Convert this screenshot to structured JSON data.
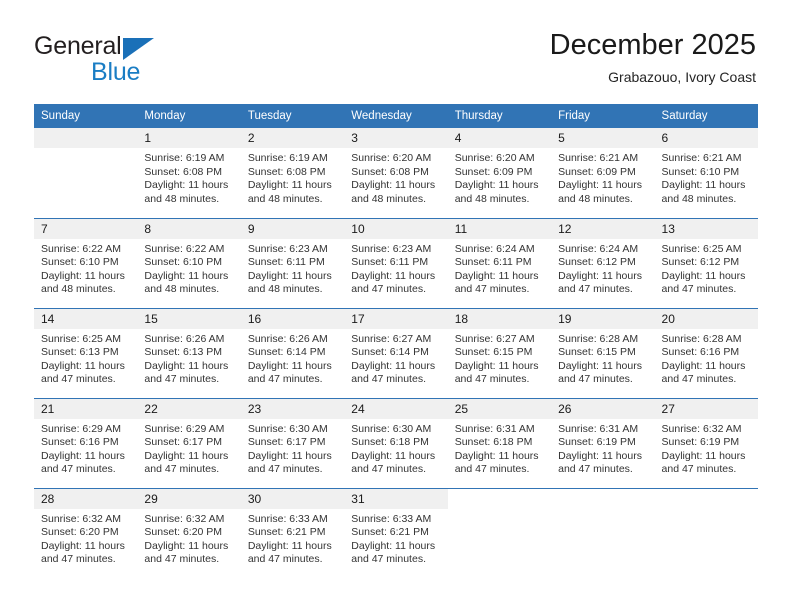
{
  "brand": {
    "name_dark": "General",
    "name_blue": "Blue",
    "triangle_icon": "triangle-icon",
    "accent_color": "#1a70b8"
  },
  "header": {
    "title": "December 2025",
    "subtitle": "Grabazouo, Ivory Coast"
  },
  "colors": {
    "header_blue": "#3174b5",
    "daynum_band": "#f0f0f0",
    "text": "#333333"
  },
  "calendar": {
    "weekday_headers": [
      "Sunday",
      "Monday",
      "Tuesday",
      "Wednesday",
      "Thursday",
      "Friday",
      "Saturday"
    ],
    "weeks": [
      [
        {
          "day": "",
          "sunrise": "",
          "sunset": "",
          "daylight": "",
          "state": "empty"
        },
        {
          "day": "1",
          "sunrise": "Sunrise: 6:19 AM",
          "sunset": "Sunset: 6:08 PM",
          "daylight": "Daylight: 11 hours and 48 minutes.",
          "state": "filled"
        },
        {
          "day": "2",
          "sunrise": "Sunrise: 6:19 AM",
          "sunset": "Sunset: 6:08 PM",
          "daylight": "Daylight: 11 hours and 48 minutes.",
          "state": "filled"
        },
        {
          "day": "3",
          "sunrise": "Sunrise: 6:20 AM",
          "sunset": "Sunset: 6:08 PM",
          "daylight": "Daylight: 11 hours and 48 minutes.",
          "state": "filled"
        },
        {
          "day": "4",
          "sunrise": "Sunrise: 6:20 AM",
          "sunset": "Sunset: 6:09 PM",
          "daylight": "Daylight: 11 hours and 48 minutes.",
          "state": "filled"
        },
        {
          "day": "5",
          "sunrise": "Sunrise: 6:21 AM",
          "sunset": "Sunset: 6:09 PM",
          "daylight": "Daylight: 11 hours and 48 minutes.",
          "state": "filled"
        },
        {
          "day": "6",
          "sunrise": "Sunrise: 6:21 AM",
          "sunset": "Sunset: 6:10 PM",
          "daylight": "Daylight: 11 hours and 48 minutes.",
          "state": "filled"
        }
      ],
      [
        {
          "day": "7",
          "sunrise": "Sunrise: 6:22 AM",
          "sunset": "Sunset: 6:10 PM",
          "daylight": "Daylight: 11 hours and 48 minutes.",
          "state": "filled"
        },
        {
          "day": "8",
          "sunrise": "Sunrise: 6:22 AM",
          "sunset": "Sunset: 6:10 PM",
          "daylight": "Daylight: 11 hours and 48 minutes.",
          "state": "filled"
        },
        {
          "day": "9",
          "sunrise": "Sunrise: 6:23 AM",
          "sunset": "Sunset: 6:11 PM",
          "daylight": "Daylight: 11 hours and 48 minutes.",
          "state": "filled"
        },
        {
          "day": "10",
          "sunrise": "Sunrise: 6:23 AM",
          "sunset": "Sunset: 6:11 PM",
          "daylight": "Daylight: 11 hours and 47 minutes.",
          "state": "filled"
        },
        {
          "day": "11",
          "sunrise": "Sunrise: 6:24 AM",
          "sunset": "Sunset: 6:11 PM",
          "daylight": "Daylight: 11 hours and 47 minutes.",
          "state": "filled"
        },
        {
          "day": "12",
          "sunrise": "Sunrise: 6:24 AM",
          "sunset": "Sunset: 6:12 PM",
          "daylight": "Daylight: 11 hours and 47 minutes.",
          "state": "filled"
        },
        {
          "day": "13",
          "sunrise": "Sunrise: 6:25 AM",
          "sunset": "Sunset: 6:12 PM",
          "daylight": "Daylight: 11 hours and 47 minutes.",
          "state": "filled"
        }
      ],
      [
        {
          "day": "14",
          "sunrise": "Sunrise: 6:25 AM",
          "sunset": "Sunset: 6:13 PM",
          "daylight": "Daylight: 11 hours and 47 minutes.",
          "state": "filled"
        },
        {
          "day": "15",
          "sunrise": "Sunrise: 6:26 AM",
          "sunset": "Sunset: 6:13 PM",
          "daylight": "Daylight: 11 hours and 47 minutes.",
          "state": "filled"
        },
        {
          "day": "16",
          "sunrise": "Sunrise: 6:26 AM",
          "sunset": "Sunset: 6:14 PM",
          "daylight": "Daylight: 11 hours and 47 minutes.",
          "state": "filled"
        },
        {
          "day": "17",
          "sunrise": "Sunrise: 6:27 AM",
          "sunset": "Sunset: 6:14 PM",
          "daylight": "Daylight: 11 hours and 47 minutes.",
          "state": "filled"
        },
        {
          "day": "18",
          "sunrise": "Sunrise: 6:27 AM",
          "sunset": "Sunset: 6:15 PM",
          "daylight": "Daylight: 11 hours and 47 minutes.",
          "state": "filled"
        },
        {
          "day": "19",
          "sunrise": "Sunrise: 6:28 AM",
          "sunset": "Sunset: 6:15 PM",
          "daylight": "Daylight: 11 hours and 47 minutes.",
          "state": "filled"
        },
        {
          "day": "20",
          "sunrise": "Sunrise: 6:28 AM",
          "sunset": "Sunset: 6:16 PM",
          "daylight": "Daylight: 11 hours and 47 minutes.",
          "state": "filled"
        }
      ],
      [
        {
          "day": "21",
          "sunrise": "Sunrise: 6:29 AM",
          "sunset": "Sunset: 6:16 PM",
          "daylight": "Daylight: 11 hours and 47 minutes.",
          "state": "filled"
        },
        {
          "day": "22",
          "sunrise": "Sunrise: 6:29 AM",
          "sunset": "Sunset: 6:17 PM",
          "daylight": "Daylight: 11 hours and 47 minutes.",
          "state": "filled"
        },
        {
          "day": "23",
          "sunrise": "Sunrise: 6:30 AM",
          "sunset": "Sunset: 6:17 PM",
          "daylight": "Daylight: 11 hours and 47 minutes.",
          "state": "filled"
        },
        {
          "day": "24",
          "sunrise": "Sunrise: 6:30 AM",
          "sunset": "Sunset: 6:18 PM",
          "daylight": "Daylight: 11 hours and 47 minutes.",
          "state": "filled"
        },
        {
          "day": "25",
          "sunrise": "Sunrise: 6:31 AM",
          "sunset": "Sunset: 6:18 PM",
          "daylight": "Daylight: 11 hours and 47 minutes.",
          "state": "filled"
        },
        {
          "day": "26",
          "sunrise": "Sunrise: 6:31 AM",
          "sunset": "Sunset: 6:19 PM",
          "daylight": "Daylight: 11 hours and 47 minutes.",
          "state": "filled"
        },
        {
          "day": "27",
          "sunrise": "Sunrise: 6:32 AM",
          "sunset": "Sunset: 6:19 PM",
          "daylight": "Daylight: 11 hours and 47 minutes.",
          "state": "filled"
        }
      ],
      [
        {
          "day": "28",
          "sunrise": "Sunrise: 6:32 AM",
          "sunset": "Sunset: 6:20 PM",
          "daylight": "Daylight: 11 hours and 47 minutes.",
          "state": "filled"
        },
        {
          "day": "29",
          "sunrise": "Sunrise: 6:32 AM",
          "sunset": "Sunset: 6:20 PM",
          "daylight": "Daylight: 11 hours and 47 minutes.",
          "state": "filled"
        },
        {
          "day": "30",
          "sunrise": "Sunrise: 6:33 AM",
          "sunset": "Sunset: 6:21 PM",
          "daylight": "Daylight: 11 hours and 47 minutes.",
          "state": "filled"
        },
        {
          "day": "31",
          "sunrise": "Sunrise: 6:33 AM",
          "sunset": "Sunset: 6:21 PM",
          "daylight": "Daylight: 11 hours and 47 minutes.",
          "state": "filled"
        },
        {
          "day": "",
          "sunrise": "",
          "sunset": "",
          "daylight": "",
          "state": "blank"
        },
        {
          "day": "",
          "sunrise": "",
          "sunset": "",
          "daylight": "",
          "state": "blank"
        },
        {
          "day": "",
          "sunrise": "",
          "sunset": "",
          "daylight": "",
          "state": "blank"
        }
      ]
    ]
  }
}
